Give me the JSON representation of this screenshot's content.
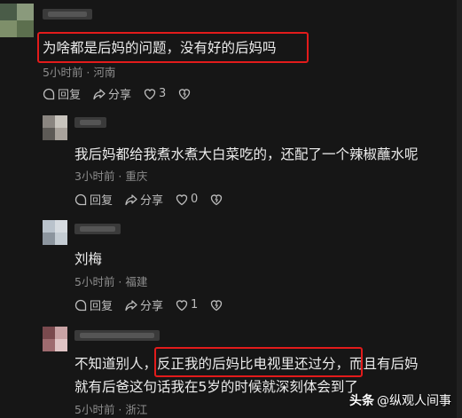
{
  "comments": [
    {
      "text": "为啥都是后妈的问题，没有好的后妈吗",
      "meta": "5小时前 · 河南",
      "reply_label": "回复",
      "share_label": "分享",
      "like_count": "3"
    },
    {
      "text": "我后妈都给我煮水煮大白菜吃的，还配了一个辣椒蘸水呢",
      "meta": "3小时前 · 重庆",
      "reply_label": "回复",
      "share_label": "分享",
      "like_count": "0"
    },
    {
      "text": "刘梅",
      "meta": "5小时前 · 福建",
      "reply_label": "回复",
      "share_label": "分享",
      "like_count": "1"
    },
    {
      "text_before": "不知道别人，",
      "text_highlight": "反正我的后妈比电视里还过分",
      "text_after": "，而且有后妈",
      "text_line2": "就有后爸这句话我在5岁的时候就深刻体会到了",
      "meta": "5小时前 · 浙江"
    }
  ],
  "watermark": {
    "brand": "头条",
    "handle": "@纵观人间事"
  },
  "icons": [
    "reply-icon",
    "share-icon",
    "like-icon",
    "dislike-icon"
  ],
  "colors": {
    "highlight": "#e21b1b",
    "background": "#161616"
  }
}
